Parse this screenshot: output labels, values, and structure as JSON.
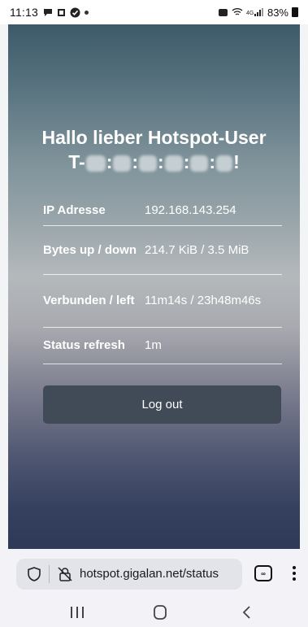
{
  "status_bar": {
    "time": "11:13",
    "battery": "83%"
  },
  "page": {
    "greeting_line1": "Hallo lieber Hotspot-User",
    "greeting_prefix": "T-",
    "greeting_suffix": "!",
    "rows": [
      {
        "label": "IP Adresse",
        "value": "192.168.143.254"
      },
      {
        "label": "Bytes up / down",
        "value": "214.7 KiB / 3.5 MiB"
      },
      {
        "label": "Verbunden / left",
        "value": "11m14s / 23h48m46s"
      },
      {
        "label": "Status refresh",
        "value": "1m"
      }
    ],
    "logout_label": "Log out"
  },
  "browser": {
    "url": "hotspot.gigalan.net/status"
  },
  "icons": {
    "shield": "shield-icon",
    "no-lock": "crossed-lock-icon",
    "tabs": "tabs-icon",
    "menu": "more-vert-icon",
    "recent": "recent-apps-icon",
    "home": "home-icon",
    "back": "back-icon"
  }
}
